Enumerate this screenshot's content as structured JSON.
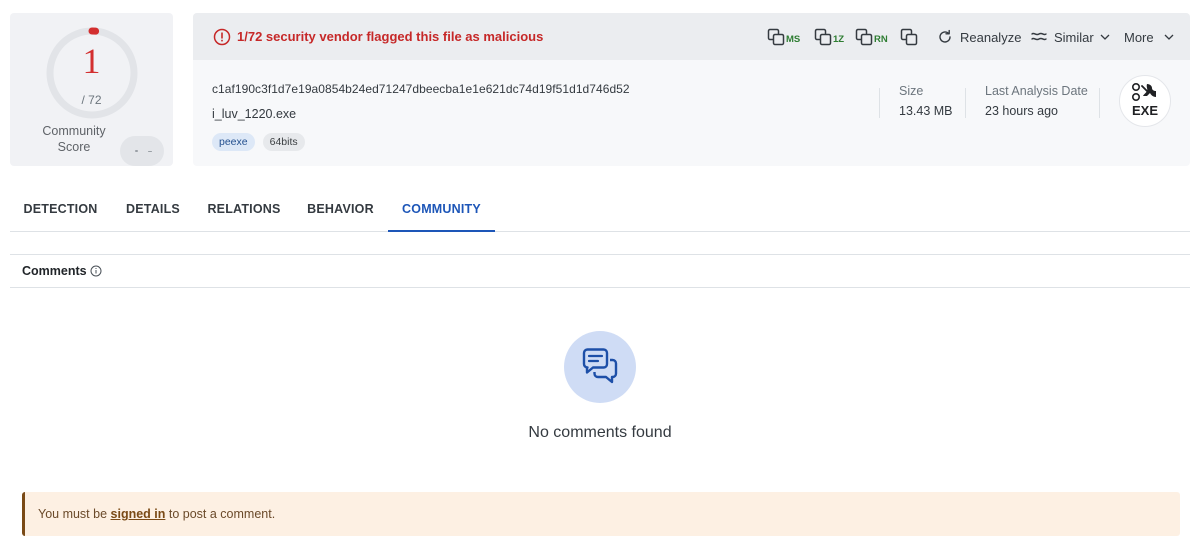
{
  "score": {
    "detections": "1",
    "total": "/ 72",
    "community_label_line1": "Community",
    "community_label_line2": "Score",
    "ring_fraction": 0.0139,
    "ring_color": "#d32f2f"
  },
  "alert": {
    "icon": "alert-circle-icon",
    "text": "1/72 security vendor flagged this file as malicious",
    "color": "#c62828"
  },
  "toolbar": {
    "copy_md5_tag": "MS",
    "copy_sha1_tag": "1Z",
    "copy_sha256_tag": "RN",
    "reanalyze_label": "Reanalyze",
    "similar_label": "Similar",
    "more_label": "More"
  },
  "file": {
    "hash": "c1af190c3f1d7e19a0854b24ed71247dbeecba1e1e621dc74d19f51d1d746d52",
    "name": "i_luv_1220.exe",
    "tags": [
      "peexe",
      "64bits"
    ]
  },
  "meta": {
    "size_label": "Size",
    "size_value": "13.43 MB",
    "analysis_label": "Last Analysis Date",
    "analysis_value": "23 hours ago",
    "type_badge": "EXE"
  },
  "tabs": [
    {
      "label": "DETECTION",
      "active": false
    },
    {
      "label": "DETAILS",
      "active": false
    },
    {
      "label": "RELATIONS",
      "active": false
    },
    {
      "label": "BEHAVIOR",
      "active": false
    },
    {
      "label": "COMMUNITY",
      "active": true
    }
  ],
  "comments": {
    "title": "Comments",
    "empty_text": "No comments found",
    "signin_prefix": "You must be ",
    "signin_link": "signed in",
    "signin_suffix": " to post a comment."
  },
  "colors": {
    "accent": "#1d56b8",
    "malicious": "#c62828",
    "hash_tag_green": "#2e7d32"
  }
}
